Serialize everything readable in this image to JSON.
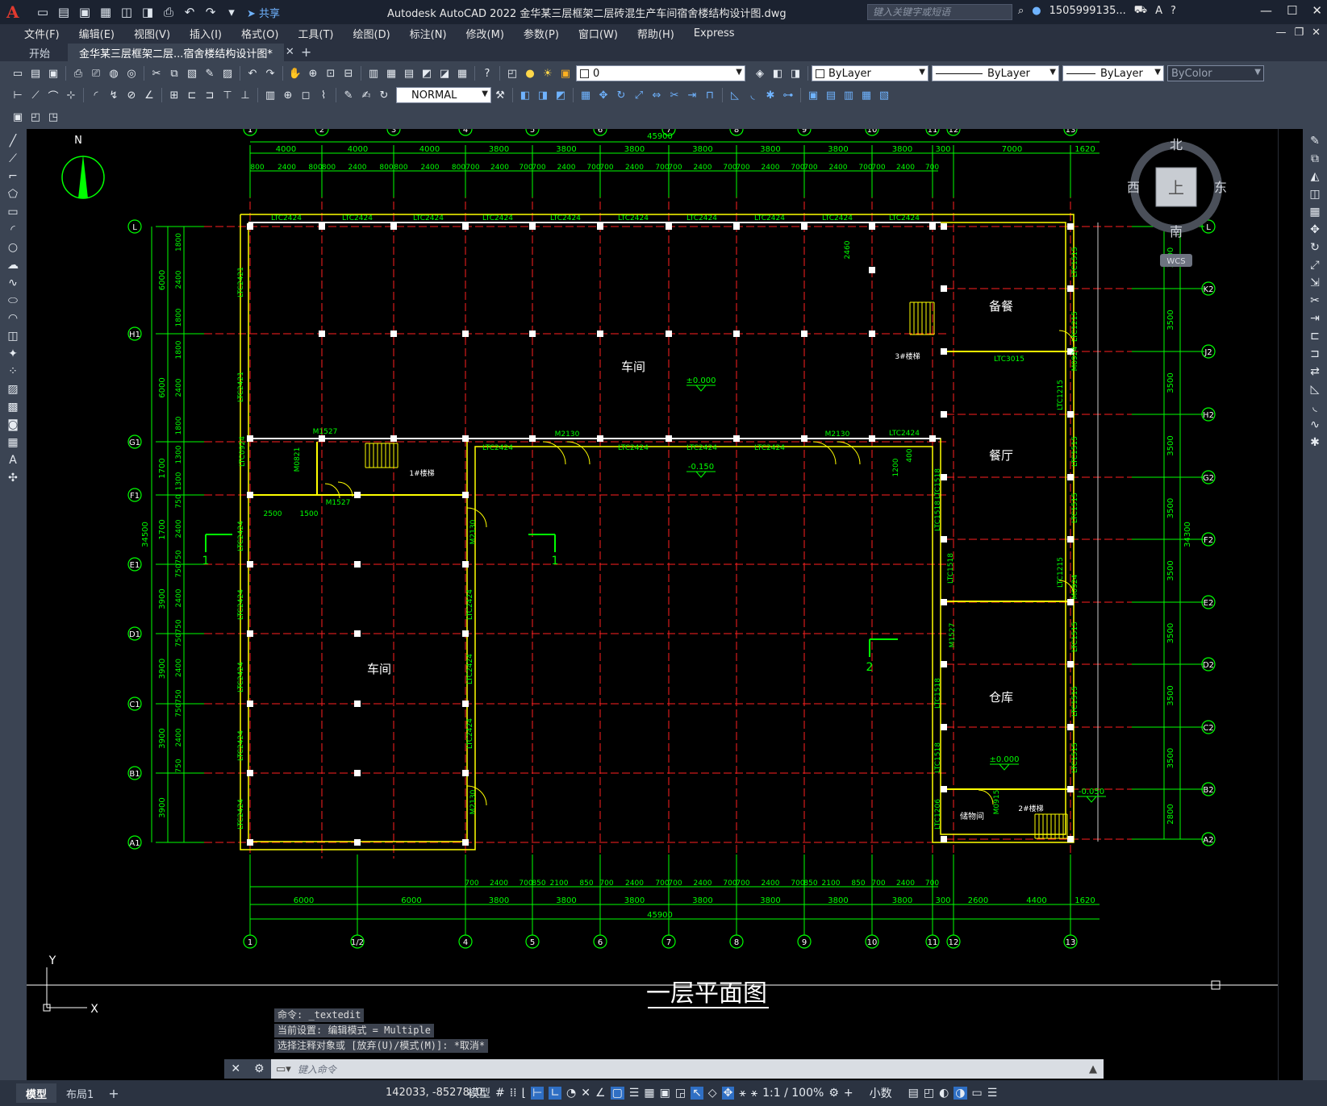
{
  "window": {
    "app_logo": "A",
    "title": "Autodesk AutoCAD 2022    金华某三层框架二层砖混生产车间宿舍楼结构设计图.dwg",
    "search_placeholder": "键入关键字或短语",
    "user": "1505999135...",
    "share_label": "共享"
  },
  "menu": [
    "文件(F)",
    "编辑(E)",
    "视图(V)",
    "插入(I)",
    "格式(O)",
    "工具(T)",
    "绘图(D)",
    "标注(N)",
    "修改(M)",
    "参数(P)",
    "窗口(W)",
    "帮助(H)",
    "Express"
  ],
  "tabs": {
    "start": "开始",
    "doc": "金华某三层框架二层...宿舍楼结构设计图*"
  },
  "toolbar": {
    "layer_value": "0",
    "color_value": "ByLayer",
    "linetype_value": "ByLayer",
    "lineweight_value": "ByLayer",
    "plotstyle_value": "ByColor",
    "dimstyle_value": "NORMAL"
  },
  "viewcube": {
    "n": "北",
    "s": "南",
    "w": "西",
    "e": "东",
    "face": "上",
    "wcs": "WCS"
  },
  "drawing": {
    "north_label": "N",
    "plan_title": "一层平面图",
    "top_overall": "45900",
    "bottom_overall": "45900",
    "left_overall": "34500",
    "right_overall": "34300",
    "top_axes": [
      "1",
      "2",
      "3",
      "4",
      "5",
      "6",
      "7",
      "8",
      "9",
      "10",
      "11",
      "12",
      "13"
    ],
    "bottom_axes": [
      "1",
      "1/2",
      "4",
      "5",
      "6",
      "7",
      "8",
      "9",
      "10",
      "11",
      "12",
      "13"
    ],
    "left_axes": [
      "L",
      "H1",
      "G1",
      "F1",
      "E1",
      "D1",
      "C1",
      "B1",
      "A1"
    ],
    "right_axes": [
      "L",
      "K2",
      "J2",
      "H2",
      "G2",
      "F2",
      "E2",
      "D2",
      "C2",
      "B2",
      "A2"
    ],
    "top_dims1": [
      "4000",
      "4000",
      "4000",
      "3800",
      "3800",
      "3800",
      "3800",
      "3800",
      "3800",
      "3800",
      "300",
      "7000",
      "1620"
    ],
    "top_dims2": [
      "800",
      "2400",
      "800",
      "800",
      "2400",
      "800",
      "800",
      "2400",
      "800",
      "700",
      "2400",
      "700",
      "700",
      "2400",
      "700",
      "700",
      "2400",
      "700",
      "700",
      "2400",
      "700",
      "700",
      "2400",
      "700",
      "700",
      "2400",
      "700",
      "700",
      "2400",
      "700"
    ],
    "bottom_dims1": [
      "6000",
      "6000",
      "3800",
      "3800",
      "3800",
      "3800",
      "3800",
      "3800",
      "3800",
      "300",
      "2600",
      "4400",
      "1620"
    ],
    "bottom_dims2": [
      "700",
      "2400",
      "700",
      "850",
      "2100",
      "850",
      "700",
      "2400",
      "700",
      "700",
      "2400",
      "700",
      "700",
      "2400",
      "700",
      "850",
      "2100",
      "850",
      "700",
      "2400",
      "700"
    ],
    "left_dims1": [
      "6000",
      "6000",
      "1700",
      "1700",
      "3900",
      "3900",
      "3900",
      "3900"
    ],
    "left_dims2": [
      "1800",
      "2400",
      "1800",
      "1800",
      "2400",
      "1800",
      "1300",
      "1300",
      "750",
      "2400",
      "750",
      "750",
      "2400",
      "750",
      "750",
      "2400",
      "750",
      "750",
      "2400",
      "750"
    ],
    "right_dims1": [
      "3500",
      "3500",
      "3500",
      "3500",
      "3500",
      "3500",
      "3500",
      "3500",
      "3500",
      "2800"
    ],
    "rooms": [
      "车间",
      "车间",
      "备餐",
      "餐厅",
      "仓库",
      "储物间"
    ],
    "stairs": [
      "1#楼梯",
      "2#楼梯",
      "3#楼梯"
    ],
    "elevations": [
      "±0.000",
      "-0.150",
      "±0.000",
      "-0.050"
    ],
    "windows": [
      "LTC2424",
      "LTC2421",
      "LTC3015",
      "LTC1515",
      "LTC1215",
      "LTC1518",
      "LTC1206",
      "LTC0924",
      "M1527",
      "M2130",
      "M0821",
      "M0924",
      "M0915"
    ],
    "section_marks": [
      "1",
      "1",
      "2"
    ],
    "misc_dims": [
      "2500",
      "1500",
      "2460",
      "1200",
      "400"
    ]
  },
  "ucs": {
    "x": "X",
    "y": "Y"
  },
  "command": {
    "history": [
      "命令: _textedit",
      "当前设置: 编辑模式 = Multiple",
      "选择注释对象或 [放弃(U)/模式(M)]: *取消*"
    ],
    "placeholder": "键入命令"
  },
  "status": {
    "model_tab": "模型",
    "layout_tab": "布局1",
    "coords": "142033, -85278, 0",
    "model_label": "模型",
    "scale": "1:1 / 100%",
    "units": "小数"
  },
  "colors": {
    "accent": "#2f6fc4",
    "canvas": "#000000",
    "dim": "#00ff00",
    "axis": "#ff2020",
    "wall": "#ffff00"
  }
}
